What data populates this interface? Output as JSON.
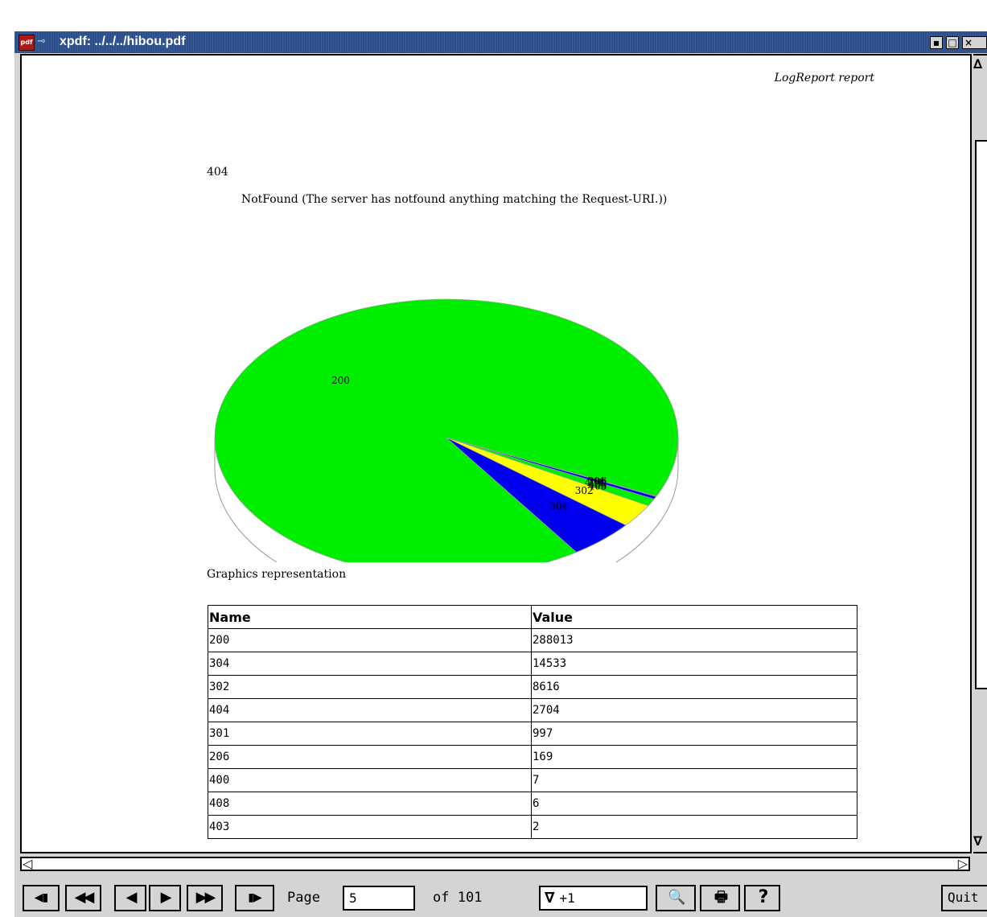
{
  "window": {
    "title": "xpdf: ../../../hibou.pdf",
    "app_icon_label": "pdf",
    "controls": {
      "minimize": "▪",
      "maximize": "□",
      "close": "×"
    }
  },
  "page": {
    "header": "LogReport report",
    "status_code": "404",
    "status_description": "NotFound (The server has notfound anything matching the Request-URI.))",
    "chart_caption": "Graphics representation",
    "table": {
      "headers": [
        "Name",
        "Value"
      ],
      "rows": [
        [
          "200",
          "288013"
        ],
        [
          "304",
          "14533"
        ],
        [
          "302",
          "8616"
        ],
        [
          "404",
          "2704"
        ],
        [
          "301",
          "997"
        ],
        [
          "206",
          "169"
        ],
        [
          "400",
          "7"
        ],
        [
          "408",
          "6"
        ],
        [
          "403",
          "2"
        ]
      ]
    }
  },
  "chart_data": {
    "type": "pie",
    "style": "3d",
    "categories": [
      "200",
      "304",
      "302",
      "404",
      "301",
      "206",
      "400",
      "408",
      "403"
    ],
    "values": [
      288013,
      14533,
      8616,
      2704,
      997,
      169,
      7,
      6,
      2
    ],
    "colors": [
      "#00ee00",
      "#0000ee",
      "#ffff00",
      "#00ee00",
      "#0000ee",
      "#ffff00",
      "#00ee00",
      "#0000ee",
      "#ffff00"
    ],
    "visible_labels": [
      "304",
      "200"
    ],
    "title": ""
  },
  "toolbar": {
    "buttons": {
      "first_page": "◀▮",
      "back_ten": "◀◀",
      "previous": "◀",
      "next": "▶",
      "forward_ten": "▶▶",
      "last_page": "▮▶",
      "find": "🔍",
      "print": "🖶",
      "help": "?"
    },
    "page_label": "Page",
    "page_value": "5",
    "of_label": "of 101",
    "zoom_arrow": "∇",
    "zoom_value": "+1",
    "quit_label": "Quit"
  },
  "scrollbars": {
    "up_arrow": "∆",
    "down_arrow": "∇",
    "left_arrow": "◁",
    "right_arrow": "▷"
  }
}
